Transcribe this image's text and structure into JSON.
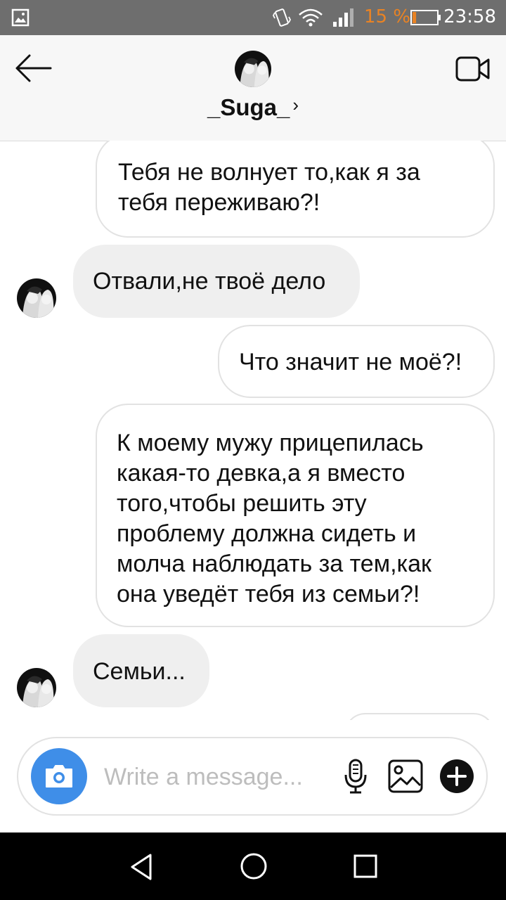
{
  "status_bar": {
    "battery_percent": "15 %",
    "battery_level": 0.15,
    "time": "23:58",
    "icons": [
      "gallery-icon",
      "vibrate-icon",
      "wifi-icon",
      "signal-icon",
      "battery-icon"
    ]
  },
  "header": {
    "contact_name": "_Suga_",
    "chevron": "›",
    "icons": [
      "back-arrow-icon",
      "avatar",
      "video-camera-icon"
    ]
  },
  "messages": [
    {
      "direction": "outgoing",
      "lines": [
        "Тебя не волнует то,как я за",
        "тебя переживаю?!"
      ]
    },
    {
      "direction": "incoming",
      "lines": [
        "Отвали,не твоё дело"
      ]
    },
    {
      "direction": "outgoing",
      "lines": [
        "Что значит не моё?!"
      ]
    },
    {
      "direction": "outgoing",
      "lines": [
        "К моему мужу прицепилась",
        "какая-то девка,а я вместо",
        "того,чтобы решить эту",
        "проблему должна сидеть и",
        "молча наблюдать за тем,как",
        "она уведёт тебя из семьи?!"
      ]
    },
    {
      "direction": "incoming",
      "lines": [
        "Семьи..."
      ]
    }
  ],
  "composer": {
    "placeholder": "Write a message...",
    "value": "",
    "icons": [
      "camera-icon",
      "microphone-icon",
      "image-icon",
      "plus-icon"
    ],
    "camera_color": "#3f8ee8"
  },
  "nav_bar": {
    "icons": [
      "nav-back-icon",
      "nav-home-icon",
      "nav-recents-icon"
    ]
  }
}
